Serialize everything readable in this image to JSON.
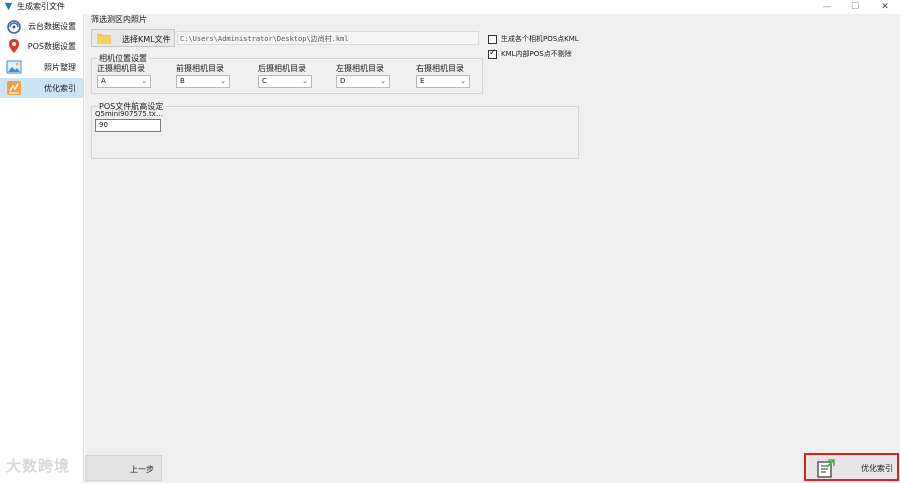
{
  "window": {
    "title": "生成索引文件"
  },
  "sidebar": {
    "items": [
      {
        "label": "云台数据设置",
        "icon": "cloud-data-icon"
      },
      {
        "label": "POS数据设置",
        "icon": "location-pin-icon"
      },
      {
        "label": "照片整理",
        "icon": "photo-icon"
      },
      {
        "label": "优化索引",
        "icon": "optimize-index-icon",
        "active": true
      }
    ]
  },
  "filter": {
    "title": "筛选测区内照片",
    "select_kml_label": "选择KML文件",
    "path_value": "C:\\Users\\Administrator\\Desktop\\边尚村.kml"
  },
  "options": {
    "generate_pos_kml_label": "生成各个相机POS点KML",
    "generate_pos_kml_checked": false,
    "kml_no_remove_label": "KML内部POS点不剔除",
    "kml_no_remove_checked": true
  },
  "camera": {
    "title": "相机位置设置",
    "columns": [
      {
        "label": "正摄相机目录",
        "value": "A"
      },
      {
        "label": "前摄相机目录",
        "value": "B"
      },
      {
        "label": "后摄相机目录",
        "value": "C"
      },
      {
        "label": "左摄相机目录",
        "value": "D"
      },
      {
        "label": "右摄相机目录",
        "value": "E"
      }
    ]
  },
  "pos_height": {
    "title": "POS文件航高设定",
    "file_name": "Q5mini907575.tx…",
    "value": "90"
  },
  "footer": {
    "watermark": "大数跨境",
    "prev_label": "上一步",
    "optimize_label": "优化索引"
  },
  "colors": {
    "active_nav_bg": "#cce4f7",
    "highlight_border": "#e02020",
    "main_bg": "#f0f0f0"
  }
}
